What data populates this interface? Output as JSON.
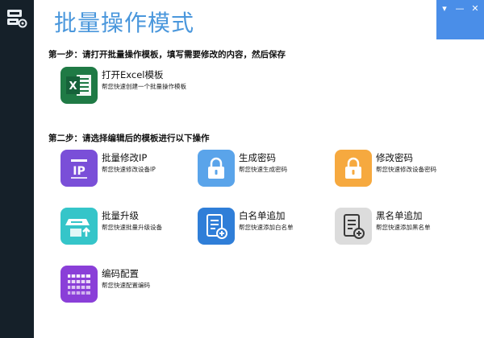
{
  "window": {
    "menu_glyph": "▾",
    "minimize_glyph": "—",
    "close_glyph": "✕"
  },
  "page": {
    "title": "批量操作模式"
  },
  "steps": {
    "step1": "第一步：请打开批量操作模板，填写需要修改的内容，然后保存",
    "step2": "第二步：请选择编辑后的模板进行以下操作"
  },
  "tiles": {
    "excel": {
      "title": "打开Excel模板",
      "desc": "帮您快速创建一个批量操作模板",
      "icon": "excel-icon",
      "color": "#1f7a45"
    },
    "modify_ip": {
      "title": "批量修改IP",
      "desc": "帮您快速修改设备IP",
      "icon": "ip-icon",
      "color": "#7a4fd8"
    },
    "gen_password": {
      "title": "生成密码",
      "desc": "帮您快速生成密码",
      "icon": "lock-icon",
      "color": "#5aa4ea"
    },
    "change_password": {
      "title": "修改密码",
      "desc": "帮您快速修改设备密码",
      "icon": "lock-icon",
      "color": "#f6a93f"
    },
    "upgrade": {
      "title": "批量升级",
      "desc": "帮您快速批量升级设备",
      "icon": "upgrade-icon",
      "color": "#35c5c9"
    },
    "whitelist": {
      "title": "白名单追加",
      "desc": "帮您快速添加白名单",
      "icon": "list-add-icon",
      "color": "#2f7ed8"
    },
    "blacklist": {
      "title": "黑名单追加",
      "desc": "帮您快速添加黑名单",
      "icon": "list-add-icon",
      "color": "#dcdcdc"
    },
    "encoding": {
      "title": "编码配置",
      "desc": "帮您快速配置编码",
      "icon": "keyboard-icon",
      "color": "#8a3fd8"
    }
  }
}
